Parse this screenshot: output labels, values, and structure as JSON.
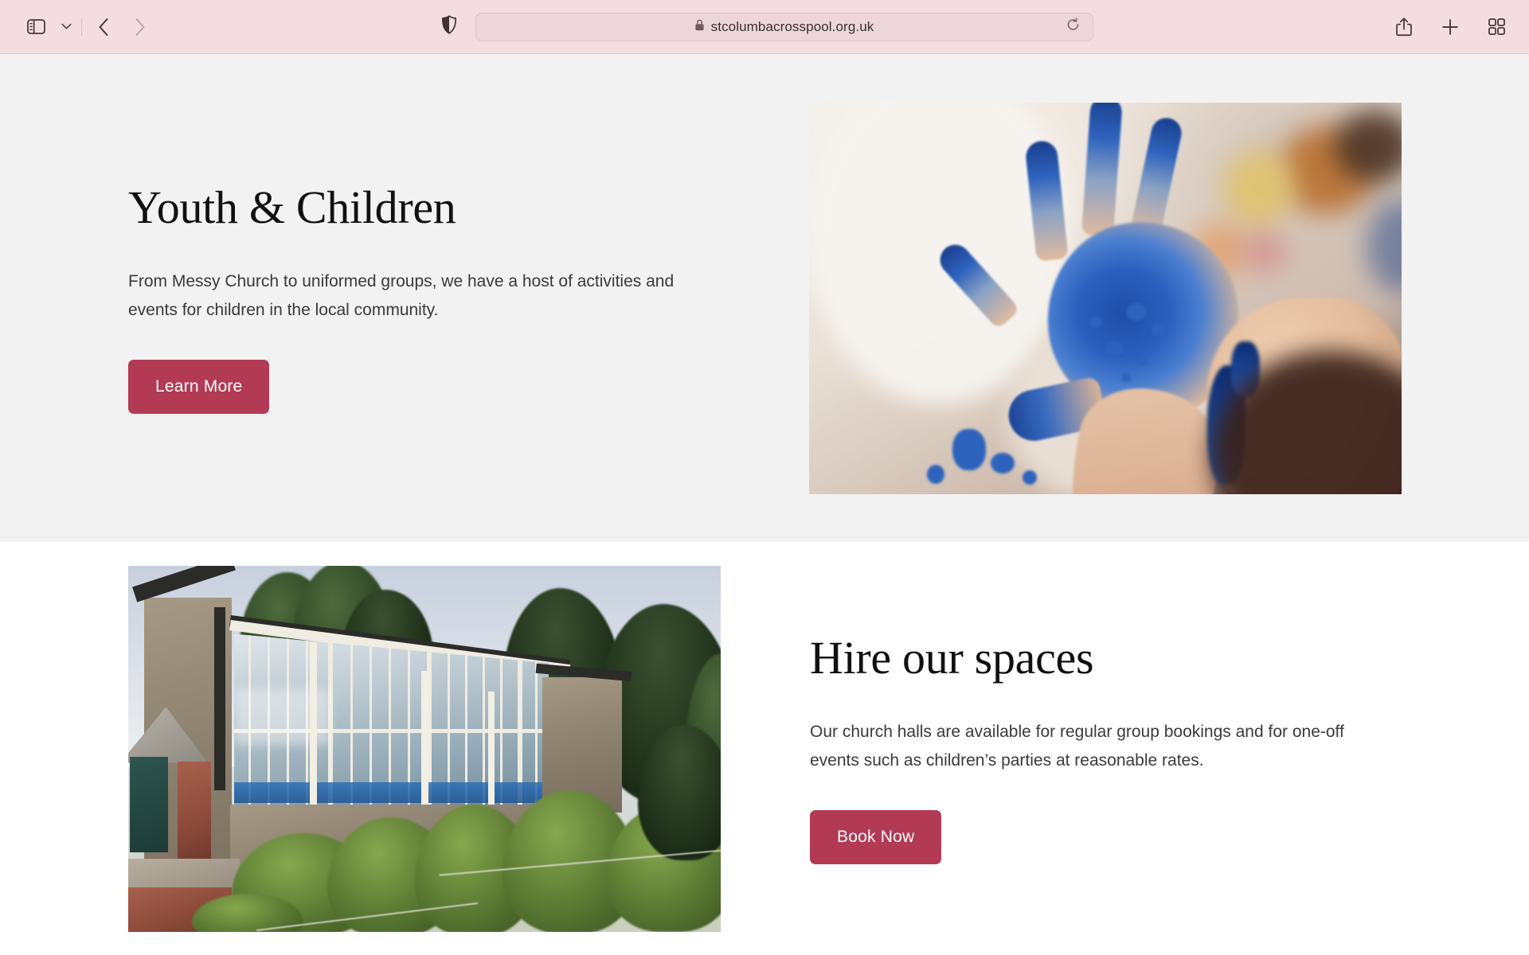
{
  "browser": {
    "sidebar_toggle_icon": "sidebar-icon",
    "tab_group_chevron_icon": "chevron-down-icon",
    "back_icon": "chevron-left-icon",
    "forward_icon": "chevron-right-icon",
    "shield_icon": "privacy-shield-icon",
    "lock_icon": "lock-icon",
    "url": "stcolumbacrosspool.org.uk",
    "url_placeholder": "Search or enter website name",
    "reload_icon": "reload-icon",
    "share_icon": "share-icon",
    "new_tab_icon": "plus-icon",
    "tab_overview_icon": "tab-overview-icon",
    "toolbar_bg": "#f4dce1",
    "url_field_bg": "#ecd6da"
  },
  "page": {
    "accent_color": "#b23a55",
    "sections": [
      {
        "id": "youth-and-children",
        "heading": "Youth & Children",
        "body": "From Messy Church to uniformed groups, we have a host of activities and events for children in the local community.",
        "cta_label": "Learn More",
        "background": "#f2f2f2",
        "image_alt": "child-hands-blue-paint",
        "layout": "text-left-image-right"
      },
      {
        "id": "hire-our-spaces",
        "heading": "Hire our spaces",
        "body": "Our church halls are available for regular group bookings and for one-off events such as children’s parties at reasonable rates.",
        "cta_label": "Book Now",
        "background": "#ffffff",
        "image_alt": "church-hall-exterior-windows",
        "layout": "image-left-text-right"
      }
    ]
  }
}
